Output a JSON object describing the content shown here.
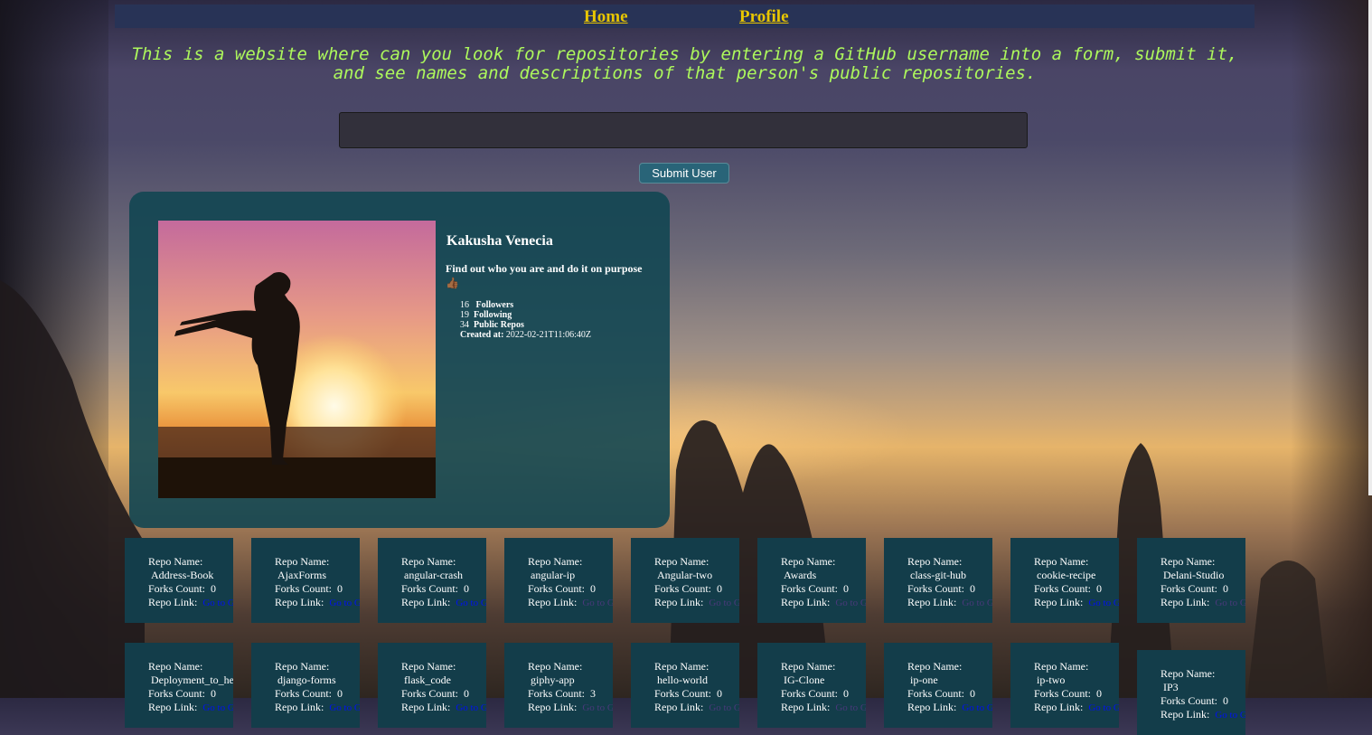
{
  "nav": {
    "home": "Home",
    "profile": "Profile"
  },
  "intro": "This is a website where can you look for repositories by entering a GitHub username into a form, submit it, and see names and descriptions of that person's public repositories.",
  "search": {
    "value": "",
    "button_label": "Submit User"
  },
  "profile": {
    "name": "Kakusha Venecia",
    "bio": "Find out who you are and do it on purpose👍🏾",
    "followers_count": "16",
    "followers_label": "Followers",
    "following_count": "19",
    "following_label": "Following",
    "repos_count": "34",
    "repos_label": "Public Repos",
    "created_label": "Created at:",
    "created_value": "2022-02-21T11:06:40Z"
  },
  "repo_labels": {
    "name": "Repo Name:",
    "forks": "Forks Count:",
    "link": "Repo Link:",
    "link_text": "Go to Github"
  },
  "repos": [
    {
      "name": "Address-Book",
      "forks": "0"
    },
    {
      "name": "AjaxForms",
      "forks": "0"
    },
    {
      "name": "angular-crash",
      "forks": "0"
    },
    {
      "name": "angular-ip",
      "forks": "0"
    },
    {
      "name": "Angular-two",
      "forks": "0"
    },
    {
      "name": "Awards",
      "forks": "0"
    },
    {
      "name": "class-git-hub",
      "forks": "0"
    },
    {
      "name": "cookie-recipe",
      "forks": "0"
    },
    {
      "name": "Delani-Studio",
      "forks": "0"
    },
    {
      "name": "Deployment_to_heroku",
      "forks": "0"
    },
    {
      "name": "django-forms",
      "forks": "0"
    },
    {
      "name": "flask_code",
      "forks": "0"
    },
    {
      "name": "giphy-app",
      "forks": "3"
    },
    {
      "name": "hello-world",
      "forks": "0"
    },
    {
      "name": "IG-Clone",
      "forks": "0"
    },
    {
      "name": "ip-one",
      "forks": "0"
    },
    {
      "name": "ip-two",
      "forks": "0"
    },
    {
      "name": "IP3",
      "forks": "0"
    }
  ],
  "colors": {
    "nav_bg": "#283356",
    "nav_link": "#e8c600",
    "intro_text": "#adf85c",
    "card_bg": "#124652",
    "repo_bg": "#133d4a",
    "button_bg": "#296478",
    "link": "#0012ee",
    "link_visited": "#49397a"
  }
}
